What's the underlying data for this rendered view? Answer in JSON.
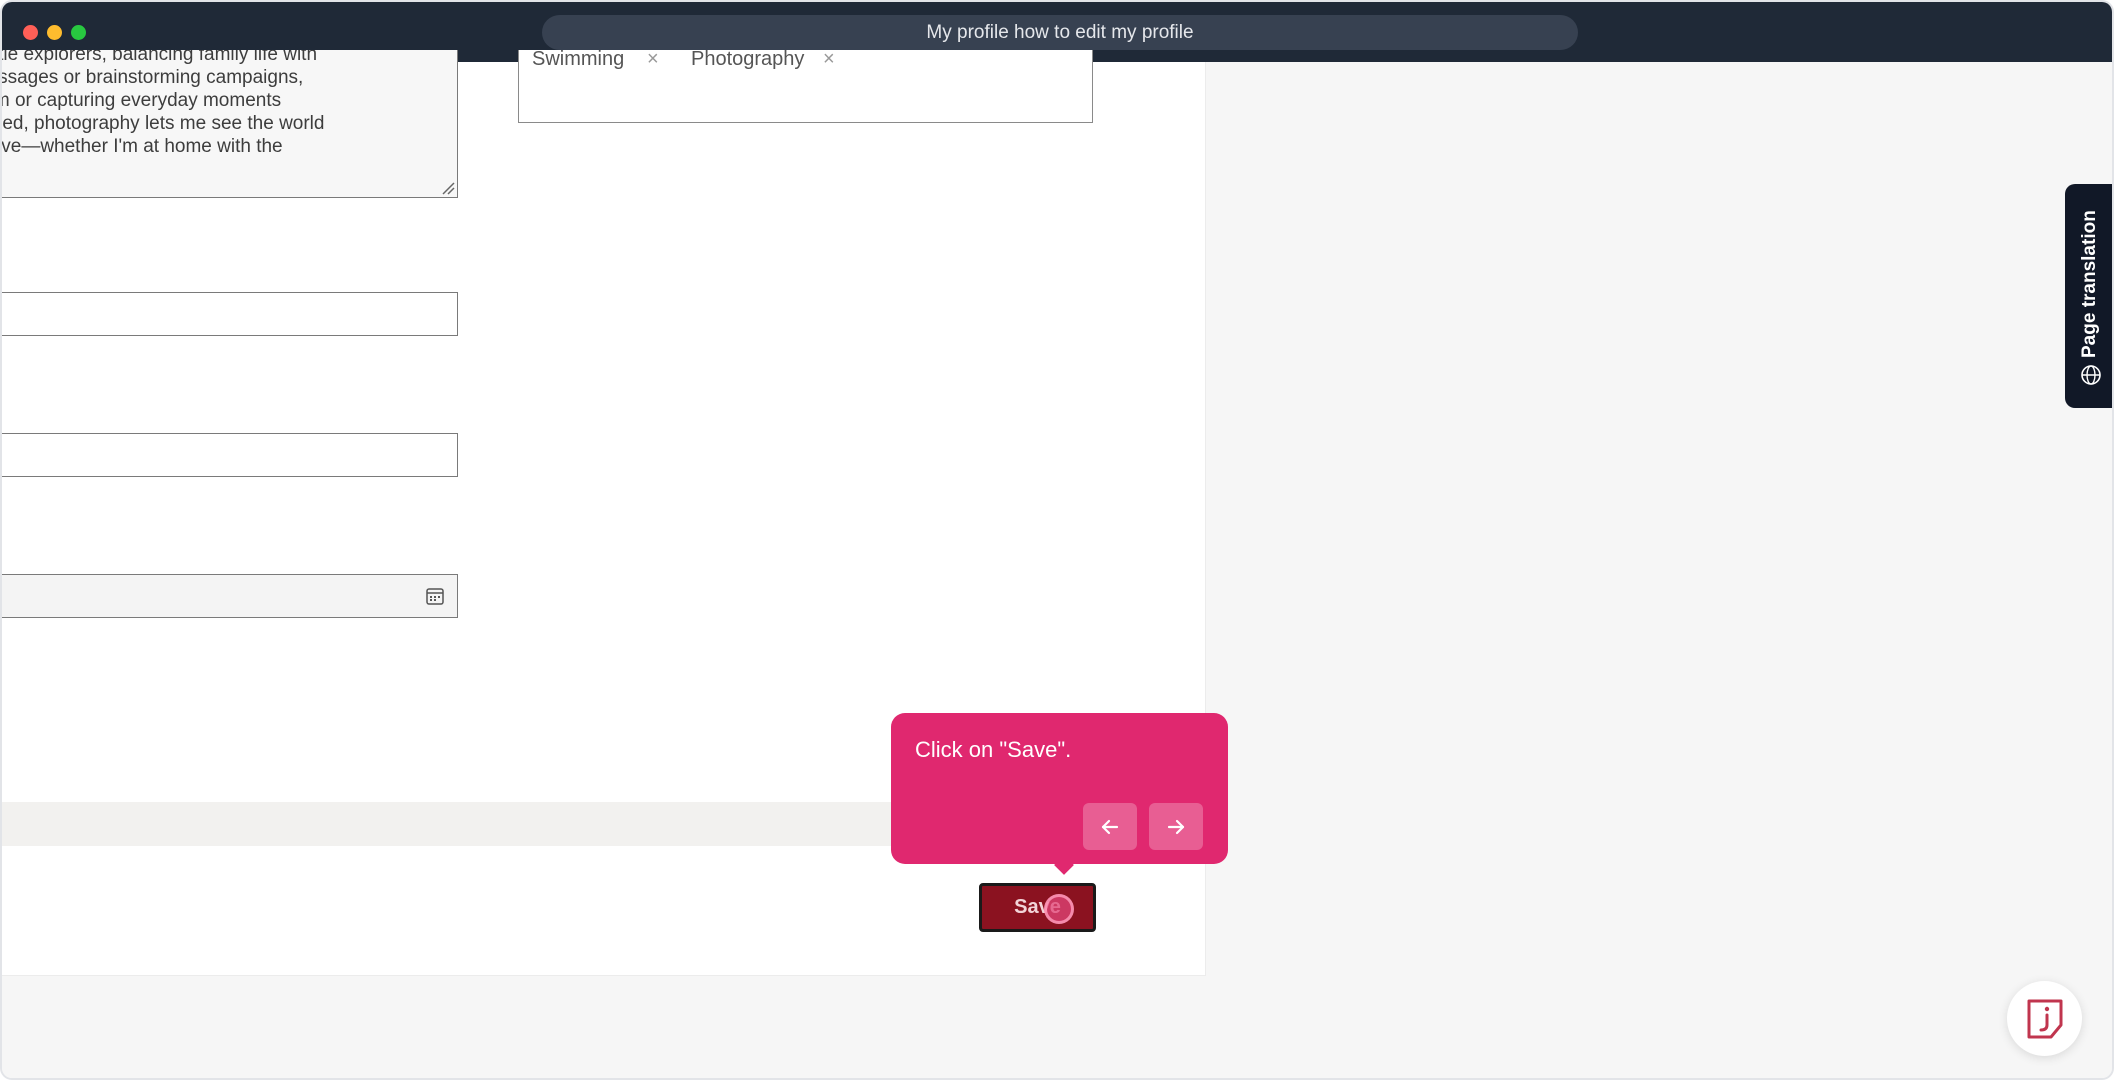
{
  "window": {
    "title": "My profile how to edit my profile"
  },
  "bio": {
    "lines": [
      "two curious little explorers, balancing family life with",
      "ot crafting messages or brainstorming campaigns,",
      "efreshing swim or capturing everyday moments",
      "ps me energized, photography lets me see the world",
      "me stay creative—whether I'm at home with the"
    ]
  },
  "interests": {
    "tags": [
      "Swimming",
      "Photography"
    ],
    "remove_glyph": "×"
  },
  "tooltip": {
    "text": "Click on \"Save\".",
    "prev_icon": "arrow-left-icon",
    "next_icon": "arrow-right-icon"
  },
  "actions": {
    "save_label": "Save"
  },
  "side_tab": {
    "label": "Page translation",
    "icon": "globe-icon"
  },
  "colors": {
    "tooltip": "#e0286f",
    "save_button": "#8b1220",
    "titlebar": "#1f2937",
    "side_tab": "#111827"
  }
}
